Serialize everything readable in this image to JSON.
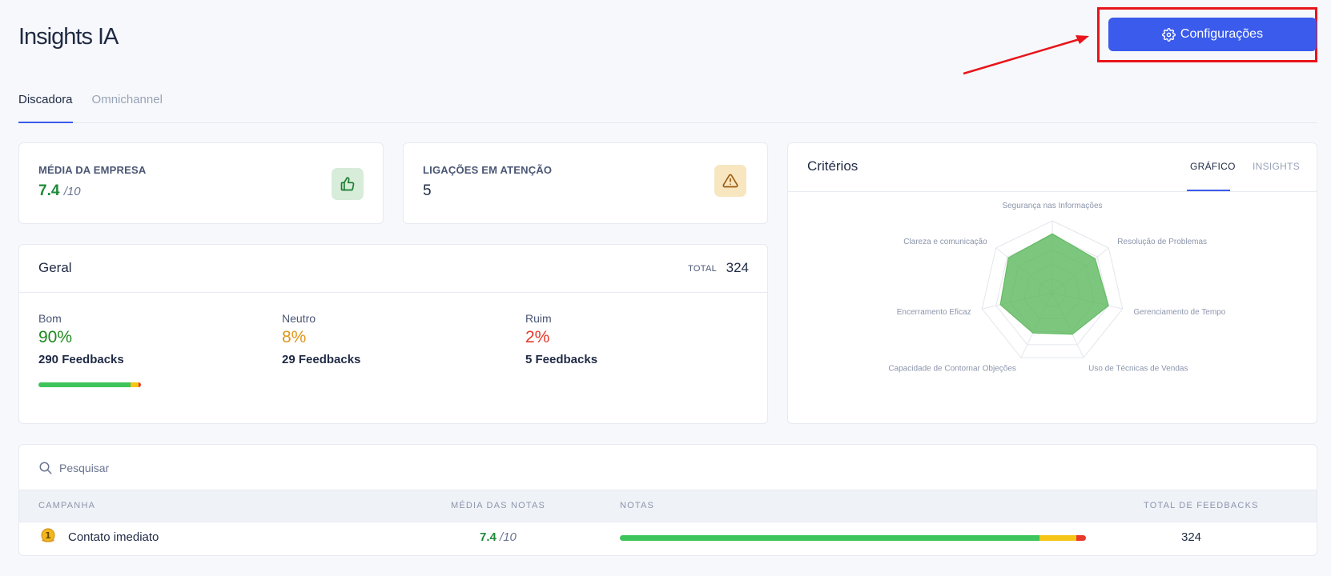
{
  "page": {
    "title": "Insights IA"
  },
  "toolbar": {
    "config_label": "Configurações"
  },
  "tabs": [
    {
      "label": "Discadora",
      "active": true
    },
    {
      "label": "Omnichannel",
      "active": false
    }
  ],
  "company_avg": {
    "label": "MÉDIA DA EMPRESA",
    "value": "7.4",
    "scale": "/10",
    "icon": "thumbs-up-icon"
  },
  "attention_calls": {
    "label": "LIGAÇÕES EM ATENÇÃO",
    "value": "5",
    "icon": "warning-icon"
  },
  "geral": {
    "title": "Geral",
    "total_label": "TOTAL",
    "total": "324",
    "items": [
      {
        "label": "Bom",
        "percent": "90%",
        "feedbacks": "290 Feedbacks",
        "color": "#1f8a1f"
      },
      {
        "label": "Neutro",
        "percent": "8%",
        "feedbacks": "29 Feedbacks",
        "color": "#e0951a"
      },
      {
        "label": "Ruim",
        "percent": "2%",
        "feedbacks": "5 Feedbacks",
        "color": "#e8392a"
      }
    ],
    "bar_fractions": [
      0.9,
      0.08,
      0.02
    ]
  },
  "criterios": {
    "title": "Critérios",
    "tabs": [
      {
        "label": "GRÁFICO",
        "active": true
      },
      {
        "label": "INSIGHTS",
        "active": false
      }
    ],
    "chart_data": {
      "type": "radar",
      "axes": [
        "Segurança nas Informações",
        "Resolução de Problemas",
        "Gerenciamento de Tempo",
        "Uso de Técnicas de Vendas",
        "Capacidade de Contornar Objeções",
        "Encerramento Eficaz",
        "Clareza e comunicação"
      ],
      "values": [
        8.2,
        7.6,
        8.0,
        6.4,
        6.2,
        7.4,
        7.8
      ],
      "max": 10,
      "fill_color": "#5cb85c"
    }
  },
  "search": {
    "placeholder": "Pesquisar"
  },
  "table": {
    "headers": {
      "campanha": "CAMPANHA",
      "media": "MÉDIA DAS NOTAS",
      "notas": "NOTAS",
      "total": "TOTAL DE FEEDBACKS"
    },
    "rows": [
      {
        "rank": "1",
        "campanha": "Contato imediato",
        "media": "7.4",
        "scale": "/10",
        "bar_fractions": [
          0.9,
          0.08,
          0.02
        ],
        "total": "324"
      }
    ]
  },
  "colors": {
    "accent": "#3a5bec",
    "good": "#3dc45a",
    "neutral": "#f5c518",
    "bad": "#e8392a",
    "highlight": "#e8141a"
  }
}
